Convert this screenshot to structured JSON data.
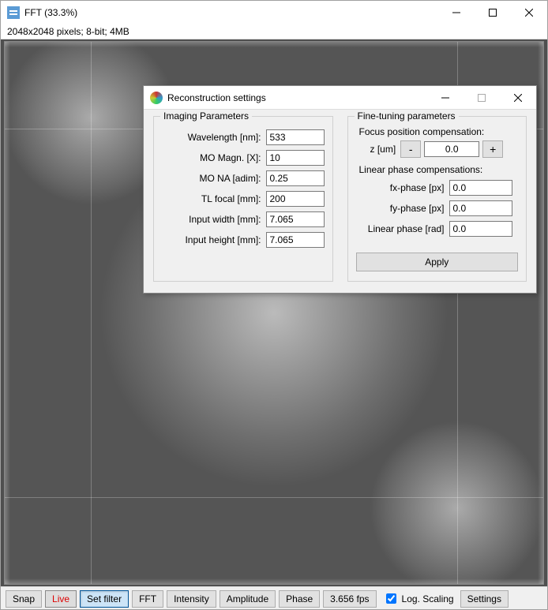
{
  "window": {
    "title": "FFT (33.3%)",
    "infoline": "2048x2048 pixels; 8-bit; 4MB"
  },
  "dialog": {
    "title": "Reconstruction settings",
    "imaging_group_title": "Imaging Parameters",
    "wavelength_label": "Wavelength [nm]:",
    "wavelength_value": "533",
    "mo_magn_label": "MO Magn. [X]:",
    "mo_magn_value": "10",
    "mo_na_label": "MO NA [adim]:",
    "mo_na_value": "0.25",
    "tl_focal_label": "TL focal [mm]:",
    "tl_focal_value": "200",
    "input_width_label": "Input width [mm]:",
    "input_width_value": "7.065",
    "input_height_label": "Input height [mm]:",
    "input_height_value": "7.065",
    "tuning_group_title": "Fine-tuning parameters",
    "focus_comp_label": "Focus position compensation:",
    "z_label": "z [um]",
    "z_value": "0.0",
    "z_minus": "-",
    "z_plus": "+",
    "linear_comp_label": "Linear phase compensations:",
    "fx_label": "fx-phase [px]",
    "fx_value": "0.0",
    "fy_label": "fy-phase [px]",
    "fy_value": "0.0",
    "lphase_label": "Linear phase [rad]",
    "lphase_value": "0.0",
    "apply_label": "Apply"
  },
  "toolbar": {
    "snap": "Snap",
    "live": "Live",
    "set_filter": "Set filter",
    "fft": "FFT",
    "intensity": "Intensity",
    "amplitude": "Amplitude",
    "phase": "Phase",
    "fps": "3.656 fps",
    "log_scaling": "Log. Scaling",
    "settings": "Settings"
  }
}
